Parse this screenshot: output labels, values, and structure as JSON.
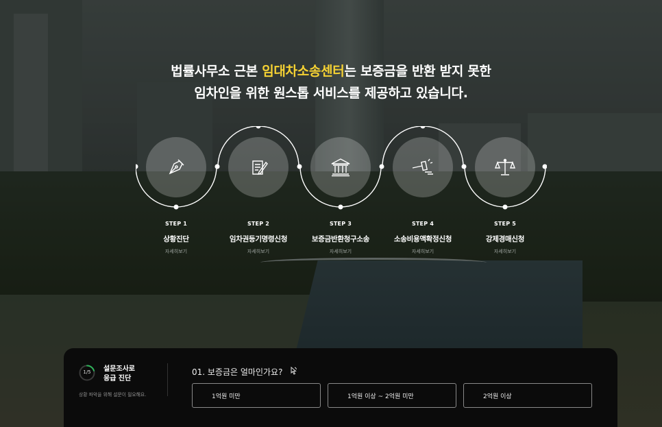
{
  "headline": {
    "line1_before": "법률사무소 근본 ",
    "line1_highlight": "임대차소송센터",
    "line1_after": "는 보증금을 반환 받지 못한",
    "line2": "임차인을 위한 원스톱 서비스를 제공하고 있습니다.",
    "highlight_color": "#f6d233"
  },
  "steps": [
    {
      "num": "STEP 1",
      "title": "상황진단",
      "more": "자세히보기",
      "icon": "fountain-pen-icon"
    },
    {
      "num": "STEP 2",
      "title": "임차권등기명령신청",
      "more": "자세히보기",
      "icon": "document-pen-icon"
    },
    {
      "num": "STEP 3",
      "title": "보증금반환청구소송",
      "more": "자세히보기",
      "icon": "courthouse-icon"
    },
    {
      "num": "STEP 4",
      "title": "소송비용액확정신청",
      "more": "자세히보기",
      "icon": "gavel-icon"
    },
    {
      "num": "STEP 5",
      "title": "강제경매신청",
      "more": "자세히보기",
      "icon": "scales-icon"
    }
  ],
  "survey": {
    "progress_label": "1/5",
    "progress": 0.2,
    "title_line1": "설문조사로",
    "title_line2": "응급 진단",
    "desc": "상황 파악을 위해 설문이 필요해요.",
    "question": "01. 보증금은 얼마인가요?",
    "question_icon": "mouse-pointer-icon",
    "options": [
      "1억원 미만",
      "1억원 이상 ~ 2억원 미만",
      "2억원 이상"
    ]
  }
}
